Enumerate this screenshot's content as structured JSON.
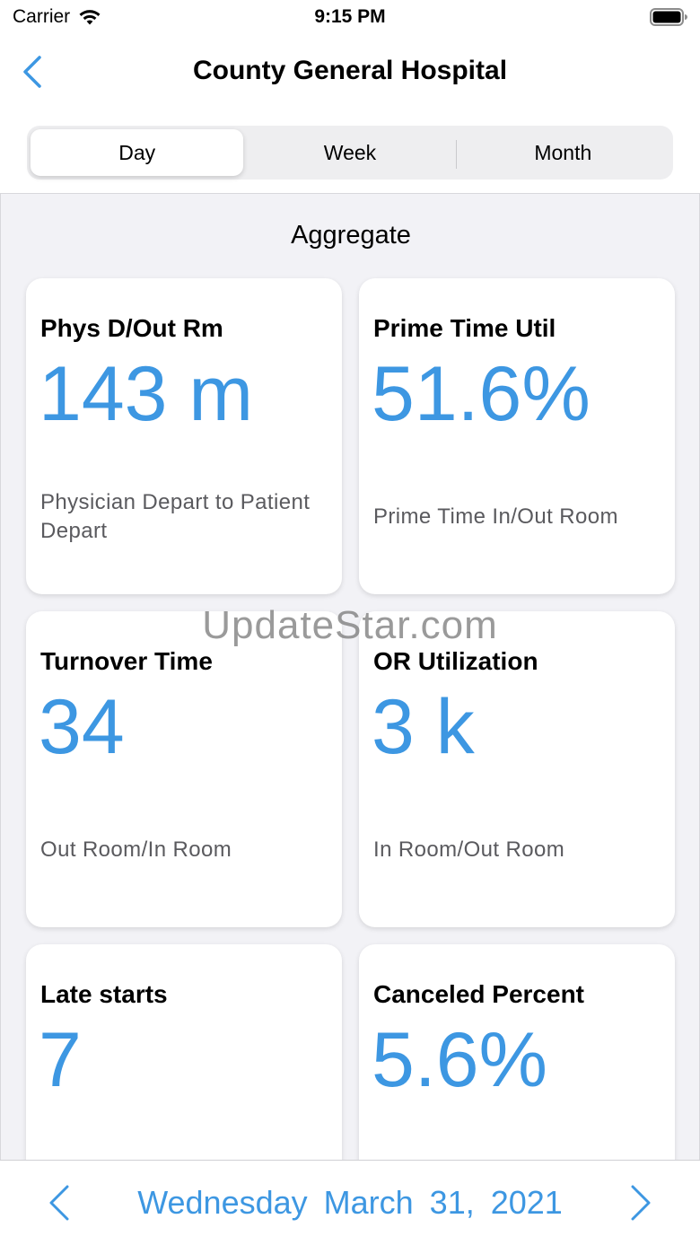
{
  "status_bar": {
    "carrier": "Carrier",
    "time": "9:15 PM"
  },
  "nav": {
    "title": "County General Hospital",
    "back_icon": "chevron-left-icon"
  },
  "segments": {
    "day": "Day",
    "week": "Week",
    "month": "Month",
    "selected": "Day"
  },
  "section": {
    "title": "Aggregate"
  },
  "cards": [
    {
      "title": "Phys D/Out Rm",
      "value": "143 m",
      "desc": "Physician Depart to Patient Depart"
    },
    {
      "title": "Prime Time Util",
      "value": "51.6%",
      "desc": "Prime Time In/Out Room"
    },
    {
      "title": "Turnover Time",
      "value": "34",
      "desc": "Out Room/In Room"
    },
    {
      "title": "OR Utilization",
      "value": "3 k",
      "desc": "In Room/Out Room"
    },
    {
      "title": "Late starts",
      "value": "7",
      "desc": ""
    },
    {
      "title": "Canceled Percent",
      "value": "5.6%",
      "desc": ""
    }
  ],
  "watermark": "UpdateStar.com",
  "footer": {
    "date": "Wednesday  March 31, 2021"
  },
  "colors": {
    "accent": "#3d97e2",
    "background": "#f2f2f6"
  }
}
